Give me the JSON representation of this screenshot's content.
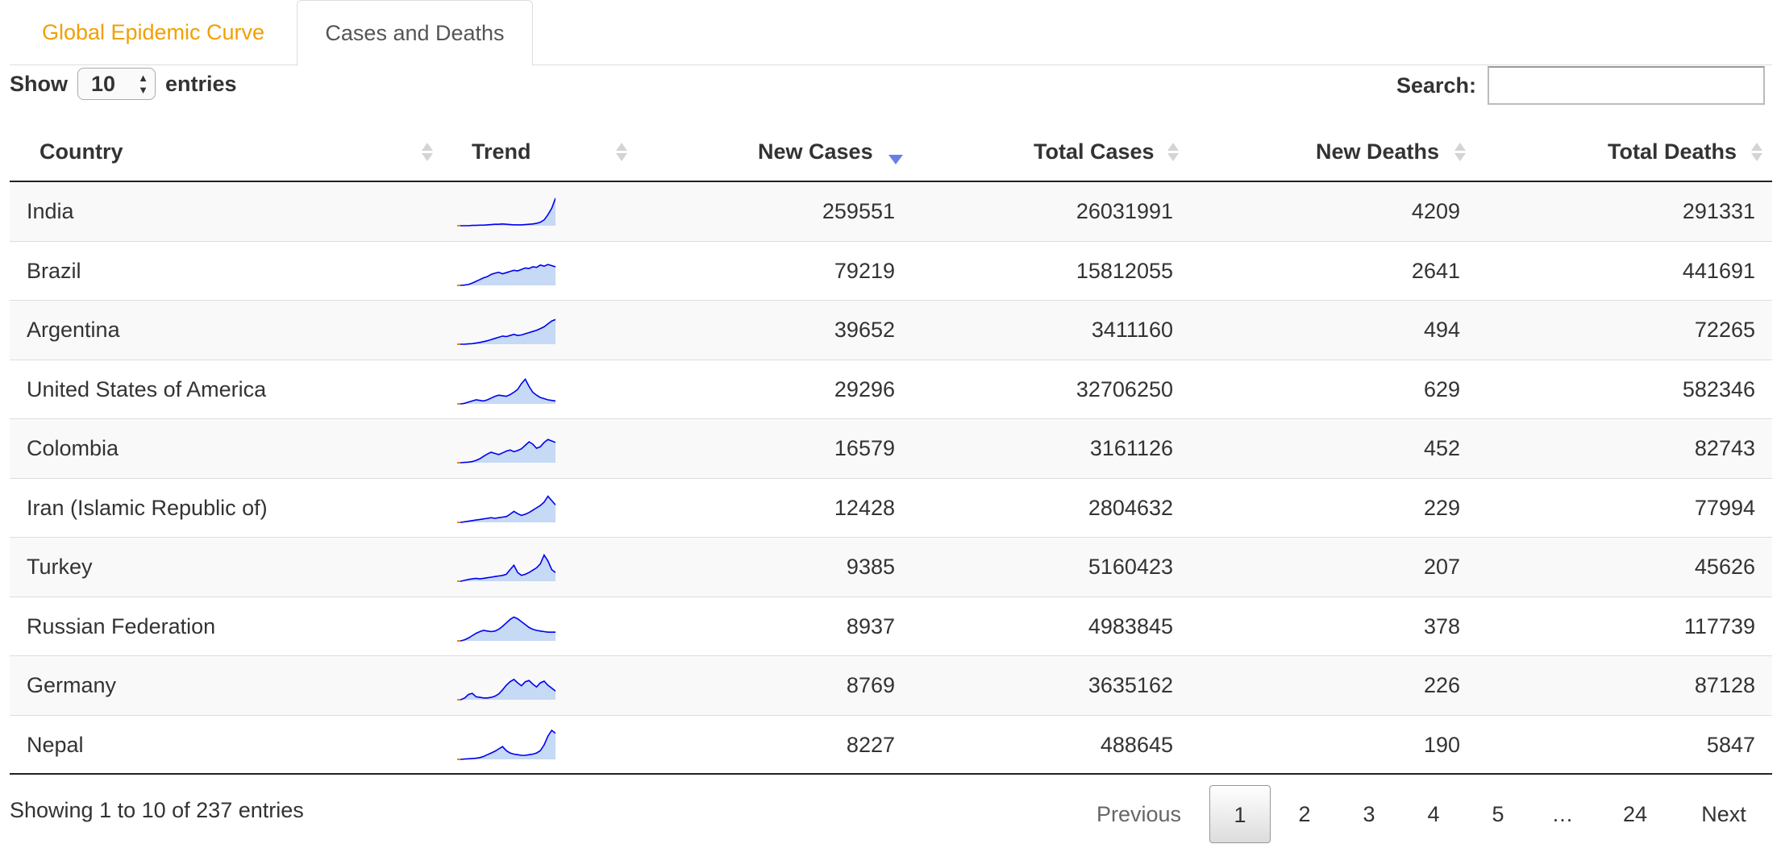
{
  "tabs": [
    {
      "label": "Global Epidemic Curve",
      "active": false
    },
    {
      "label": "Cases and Deaths",
      "active": true
    }
  ],
  "length_control": {
    "show_label": "Show",
    "value": "10",
    "entries_label": "entries"
  },
  "search": {
    "label": "Search:",
    "value": ""
  },
  "columns": [
    "Country",
    "Trend",
    "New Cases",
    "Total Cases",
    "New Deaths",
    "Total Deaths"
  ],
  "sorted_column": "New Cases",
  "sort_direction": "descending",
  "rows": [
    {
      "country": "India",
      "new_cases": "259551",
      "total_cases": "26031991",
      "new_deaths": "4209",
      "total_deaths": "291331"
    },
    {
      "country": "Brazil",
      "new_cases": "79219",
      "total_cases": "15812055",
      "new_deaths": "2641",
      "total_deaths": "441691"
    },
    {
      "country": "Argentina",
      "new_cases": "39652",
      "total_cases": "3411160",
      "new_deaths": "494",
      "total_deaths": "72265"
    },
    {
      "country": "United States of America",
      "new_cases": "29296",
      "total_cases": "32706250",
      "new_deaths": "629",
      "total_deaths": "582346"
    },
    {
      "country": "Colombia",
      "new_cases": "16579",
      "total_cases": "3161126",
      "new_deaths": "452",
      "total_deaths": "82743"
    },
    {
      "country": "Iran (Islamic Republic of)",
      "new_cases": "12428",
      "total_cases": "2804632",
      "new_deaths": "229",
      "total_deaths": "77994"
    },
    {
      "country": "Turkey",
      "new_cases": "9385",
      "total_cases": "5160423",
      "new_deaths": "207",
      "total_deaths": "45626"
    },
    {
      "country": "Russian Federation",
      "new_cases": "8937",
      "total_cases": "4983845",
      "new_deaths": "378",
      "total_deaths": "117739"
    },
    {
      "country": "Germany",
      "new_cases": "8769",
      "total_cases": "3635162",
      "new_deaths": "226",
      "total_deaths": "87128"
    },
    {
      "country": "Nepal",
      "new_cases": "8227",
      "total_cases": "488645",
      "new_deaths": "190",
      "total_deaths": "5847"
    }
  ],
  "sparkline_colors": {
    "line": "#0000ee",
    "fill": "#c6d9f5",
    "start_marker": "#f08000"
  },
  "footer": {
    "info": "Showing 1 to 10 of 237 entries",
    "previous": "Previous",
    "next": "Next",
    "pages": [
      "1",
      "2",
      "3",
      "4",
      "5",
      "…",
      "24"
    ],
    "current_page": "1"
  }
}
